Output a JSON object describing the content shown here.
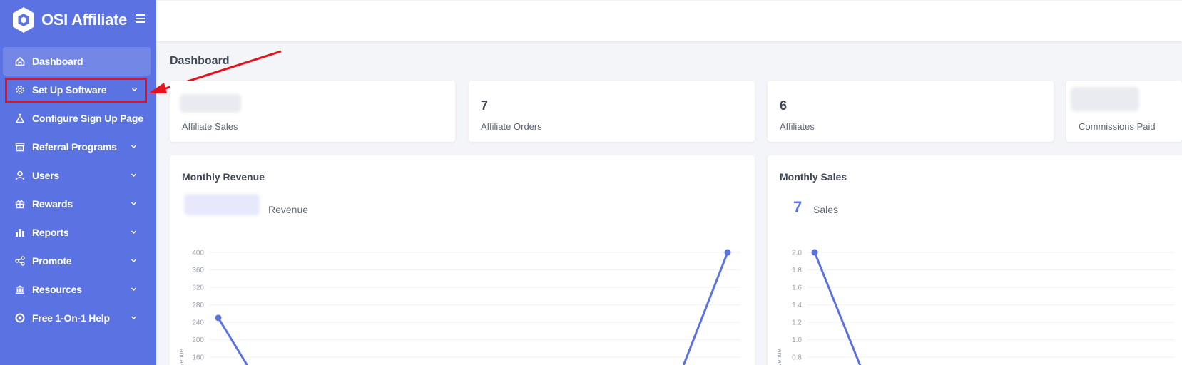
{
  "brand": {
    "name": "OSI Affiliate"
  },
  "sidebar": {
    "items": [
      {
        "label": "Dashboard",
        "icon": "home-icon",
        "chevron": false
      },
      {
        "label": "Set Up Software",
        "icon": "gear-icon",
        "chevron": true
      },
      {
        "label": "Configure Sign Up Page",
        "icon": "flask-icon",
        "chevron": false
      },
      {
        "label": "Referral Programs",
        "icon": "store-icon",
        "chevron": true
      },
      {
        "label": "Users",
        "icon": "user-icon",
        "chevron": true
      },
      {
        "label": "Rewards",
        "icon": "gift-icon",
        "chevron": true
      },
      {
        "label": "Reports",
        "icon": "bar-chart-icon",
        "chevron": true
      },
      {
        "label": "Promote",
        "icon": "share-icon",
        "chevron": true
      },
      {
        "label": "Resources",
        "icon": "bank-icon",
        "chevron": true
      },
      {
        "label": "Free 1-On-1 Help",
        "icon": "lifebuoy-icon",
        "chevron": true
      }
    ]
  },
  "page": {
    "title": "Dashboard"
  },
  "stats": [
    {
      "value": "",
      "label": "Affiliate Sales"
    },
    {
      "value": "7",
      "label": "Affiliate Orders"
    },
    {
      "value": "6",
      "label": "Affiliates"
    },
    {
      "value": "",
      "label": "Commissions Paid"
    }
  ],
  "revenue_card": {
    "title": "Monthly Revenue",
    "metric_label": "Revenue",
    "y_axis_title": "Revenue"
  },
  "sales_card": {
    "title": "Monthly Sales",
    "metric_value": "7",
    "metric_label": "Sales",
    "y_axis_title": "Revenue"
  },
  "colors": {
    "sidebar": "#5b72e3",
    "accent": "#5b72e3",
    "highlight": "#e8101a"
  },
  "chart_data": [
    {
      "type": "line",
      "y_ticks": [
        "400",
        "360",
        "320",
        "280",
        "240",
        "200",
        "160"
      ],
      "ylim": [
        160,
        400
      ],
      "ylabel": "Revenue",
      "points": [
        {
          "x": 0,
          "y": 250
        },
        {
          "x": 1,
          "y": 400
        }
      ],
      "color": "#5b72e3"
    },
    {
      "type": "line",
      "y_ticks": [
        "2.0",
        "1.8",
        "1.6",
        "1.4",
        "1.2",
        "1.0",
        "0.8"
      ],
      "ylim": [
        0.8,
        2.0
      ],
      "ylabel": "Revenue",
      "points": [
        {
          "x": 0,
          "y": 2.0
        }
      ],
      "color": "#5b72e3"
    }
  ]
}
